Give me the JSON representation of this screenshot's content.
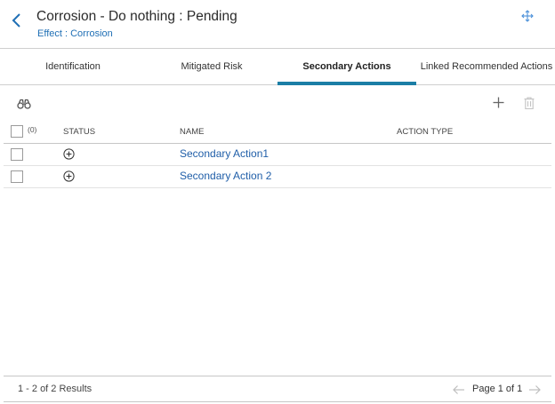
{
  "header": {
    "title": "Corrosion - Do nothing : Pending",
    "subtitle": "Effect : Corrosion",
    "back_icon": "chevron-left-icon",
    "move_icon": "move-arrows-icon"
  },
  "tabs": [
    {
      "label": "Identification",
      "active": false
    },
    {
      "label": "Mitigated Risk",
      "active": false
    },
    {
      "label": "Secondary Actions",
      "active": true
    },
    {
      "label": "Linked Recommended Actions",
      "active": false
    }
  ],
  "toolbar": {
    "search_icon": "binoculars-icon",
    "add_icon": "plus-icon",
    "delete_icon": "trash-icon"
  },
  "grid": {
    "selected_count": "(0)",
    "columns": [
      "STATUS",
      "NAME",
      "ACTION TYPE"
    ],
    "rows": [
      {
        "status_icon": "plus-circle-icon",
        "name": "Secondary Action1",
        "action_type": ""
      },
      {
        "status_icon": "plus-circle-icon",
        "name": "Secondary Action 2",
        "action_type": ""
      }
    ]
  },
  "footer": {
    "results": "1 - 2 of 2 Results",
    "page": "Page 1 of 1"
  },
  "colors": {
    "accent": "#1b7ea6",
    "link": "#1f5ea8"
  }
}
